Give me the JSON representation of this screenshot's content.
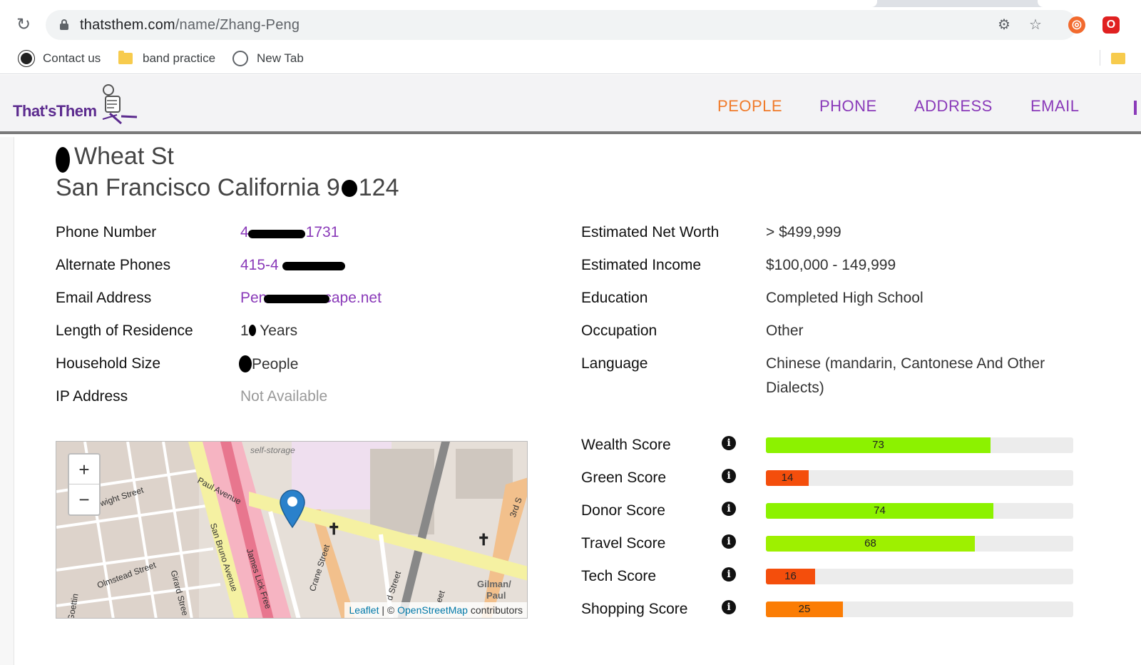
{
  "browser": {
    "url_host": "thatsthem.com",
    "url_path": "/name/Zhang-Peng",
    "bookmarks": [
      {
        "label": "Contact us"
      },
      {
        "label": "band practice"
      },
      {
        "label": "New Tab"
      }
    ]
  },
  "site": {
    "logo_text": "That'sThem",
    "nav": [
      {
        "label": "PEOPLE",
        "color": "#f07b2b"
      },
      {
        "label": "PHONE",
        "color": "#8a3ab9"
      },
      {
        "label": "ADDRESS",
        "color": "#8a3ab9"
      },
      {
        "label": "EMAIL",
        "color": "#8a3ab9"
      }
    ]
  },
  "address": {
    "street": "Wheat St",
    "city_line_a": "San Francisco California 9",
    "city_line_b": "124"
  },
  "details_left": [
    {
      "label": "Phone Number",
      "value_a": "4",
      "value_b": "1731"
    },
    {
      "label": "Alternate Phones",
      "value_a": "415-4",
      "value_b": ""
    },
    {
      "label": "Email Address",
      "value_a": "Pen",
      "value_b": "cape.net"
    },
    {
      "label": "Length of Residence",
      "value_a": "1",
      "value_b": " Years"
    },
    {
      "label": "Household Size",
      "value_a": "",
      "value_b": "People"
    },
    {
      "label": "IP Address",
      "value_a": "Not Available",
      "value_b": ""
    }
  ],
  "details_right": [
    {
      "label": "Estimated Net Worth",
      "value": "> $499,999"
    },
    {
      "label": "Estimated Income",
      "value": "$100,000 - 149,999"
    },
    {
      "label": "Education",
      "value": "Completed High School"
    },
    {
      "label": "Occupation",
      "value": "Other"
    },
    {
      "label": "Language",
      "value_line1": "Chinese (mandarin, Cantonese And Other",
      "value_line2": "Dialects)"
    }
  ],
  "map": {
    "zoom_in": "+",
    "zoom_out": "−",
    "attrib_leaflet": "Leaflet",
    "attrib_sep": " | © ",
    "attrib_osm": "OpenStreetMap",
    "attrib_contrib": " contributors",
    "labels": [
      "self-storage",
      "Paul Avenue",
      "wight Street",
      "San Bruno Avenue",
      "James Lick Free",
      "Olmstead Street",
      "Girard Stree",
      "Crane Street",
      "d Street",
      "eet",
      "Gilman/",
      "Paul",
      "3rd S",
      "Goettin"
    ]
  },
  "scores": [
    {
      "label": "Wealth Score",
      "value": 73,
      "color": "#8cf200"
    },
    {
      "label": "Green Score",
      "value": 14,
      "color": "#f44e0c"
    },
    {
      "label": "Donor Score",
      "value": 74,
      "color": "#8cf200"
    },
    {
      "label": "Travel Score",
      "value": 68,
      "color": "#9ef000"
    },
    {
      "label": "Tech Score",
      "value": 16,
      "color": "#f44e0c"
    },
    {
      "label": "Shopping Score",
      "value": 25,
      "color": "#fb7d05"
    }
  ]
}
